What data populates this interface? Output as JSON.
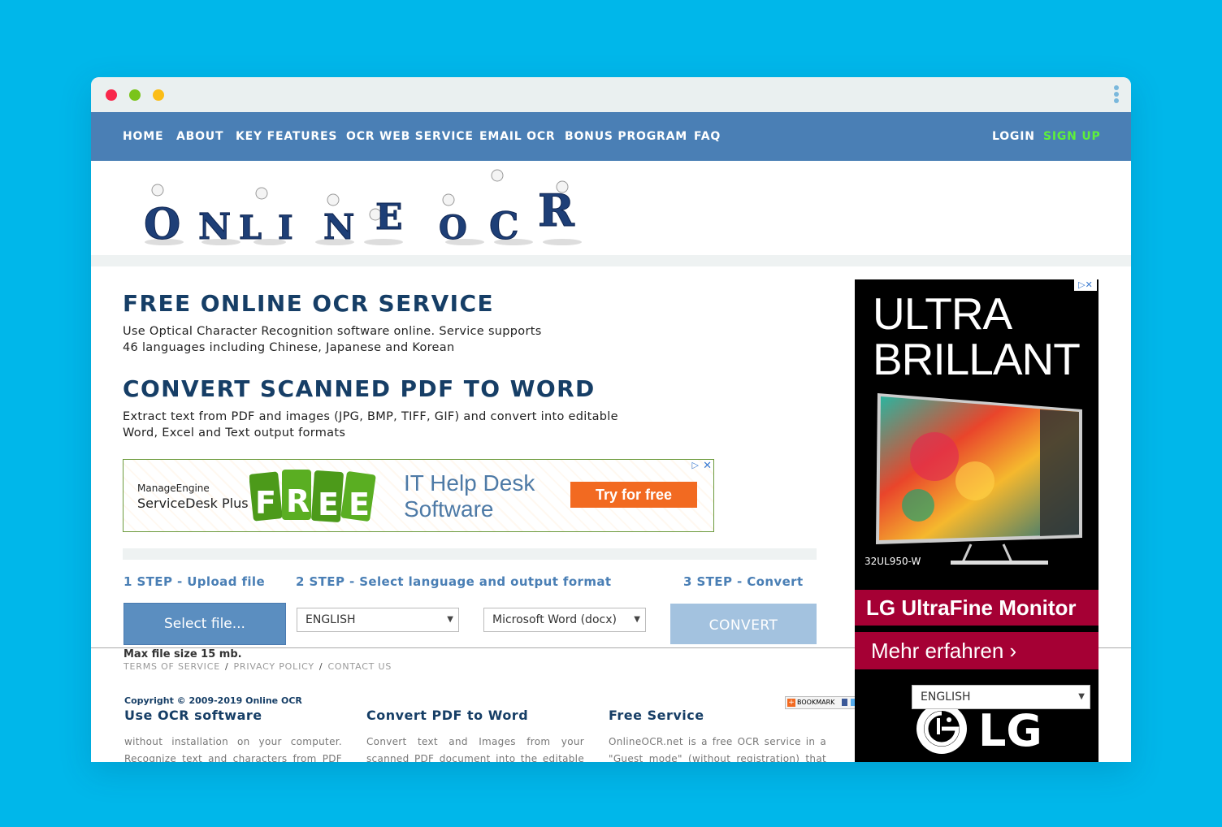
{
  "nav": {
    "items": [
      "HOME",
      "ABOUT",
      "KEY FEATURES",
      "OCR WEB SERVICE",
      "EMAIL OCR",
      "BONUS PROGRAM",
      "FAQ"
    ],
    "login": "LOGIN",
    "signup": "SIGN UP"
  },
  "logo": {
    "letters": [
      "O",
      "N",
      "L",
      "I",
      "N",
      "E",
      "O",
      "C",
      "R"
    ]
  },
  "hero": {
    "title1": "FREE ONLINE OCR SERVICE",
    "desc1_line1": "Use Optical Character Recognition software online. Service supports",
    "desc1_line2": "46 languages including Chinese, Japanese and Korean",
    "title2": "CONVERT SCANNED PDF TO WORD",
    "desc2_line1": "Extract text from PDF and images (JPG, BMP, TIFF, GIF) and convert into editable",
    "desc2_line2": "Word, Excel and Text output formats"
  },
  "banner_ad": {
    "brand": "ManageEngine",
    "product": "ServiceDesk Plus",
    "badge": [
      "F",
      "R",
      "E",
      "E"
    ],
    "title_line1": "IT Help Desk",
    "title_line2": "Software",
    "cta": "Try for free"
  },
  "steps": {
    "step1": "1 STEP - Upload file",
    "step2": "2 STEP - Select language and output format",
    "step3": "3 STEP - Convert",
    "select_file": "Select file...",
    "language": "ENGLISH",
    "format": "Microsoft Word (docx)",
    "convert": "CONVERT",
    "max_size": "Max file size 15 mb."
  },
  "footer": {
    "links": [
      "TERMS OF SERVICE",
      "PRIVACY POLICY",
      "CONTACT US"
    ],
    "copyright": "Copyright © 2009-2019 Online OCR",
    "bookmark": "BOOKMARK",
    "columns": [
      {
        "title": "Use OCR software",
        "text": "without installation on your computer. Recognize text and characters from PDF"
      },
      {
        "title": "Convert PDF to Word",
        "text": "Convert text and Images from your scanned PDF document into the editable"
      },
      {
        "title": "Free Service",
        "text": "OnlineOCR.net is a free OCR service in a \"Guest mode\" (without registration) that"
      }
    ]
  },
  "side_ad": {
    "headline_line1": "ULTRA",
    "headline_line2": "BRILLANT",
    "model": "32UL950-W",
    "band": "LG UltraFine Monitor",
    "cta": "Mehr erfahren ›",
    "logo_text": "LG"
  },
  "lang_overlay": {
    "value": "ENGLISH"
  },
  "colors": {
    "background": "#00b7ea",
    "navbar": "#4a7fb5",
    "heading": "#163e66",
    "signup": "#5df03a",
    "lg_red": "#a50034",
    "cta_orange": "#f26a21"
  }
}
